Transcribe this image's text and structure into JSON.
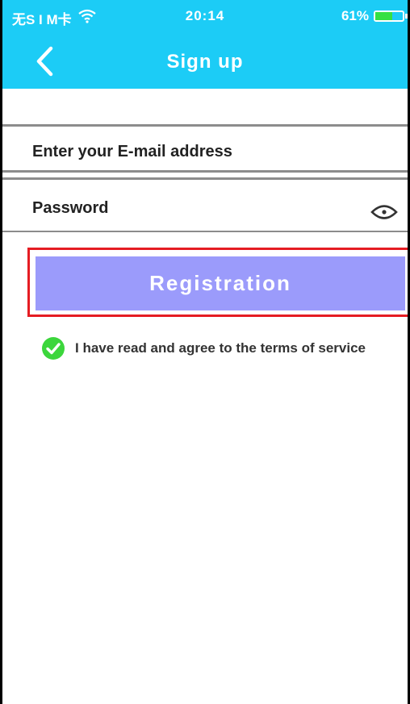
{
  "status_bar": {
    "carrier": "无S I M卡",
    "time": "20:14",
    "battery_percent_label": "61%",
    "battery_level": 0.61,
    "wifi_icon": "wifi-icon",
    "battery_icon": "battery-icon"
  },
  "nav": {
    "title": "Sign up",
    "back_icon": "chevron-left-icon"
  },
  "form": {
    "email_placeholder": "Enter your E-mail address",
    "email_value": "",
    "password_placeholder": "Password",
    "password_value": "",
    "eye_icon": "eye-icon"
  },
  "registration": {
    "label": "Registration"
  },
  "terms": {
    "checked": true,
    "label": "I have read and agree to the terms of service",
    "check_icon": "check-circle-icon"
  },
  "colors": {
    "header": "#1cccf6",
    "button": "#9b9bfb",
    "highlight": "#e51c23",
    "check": "#3cd63c",
    "battery_fill": "#35e043"
  }
}
